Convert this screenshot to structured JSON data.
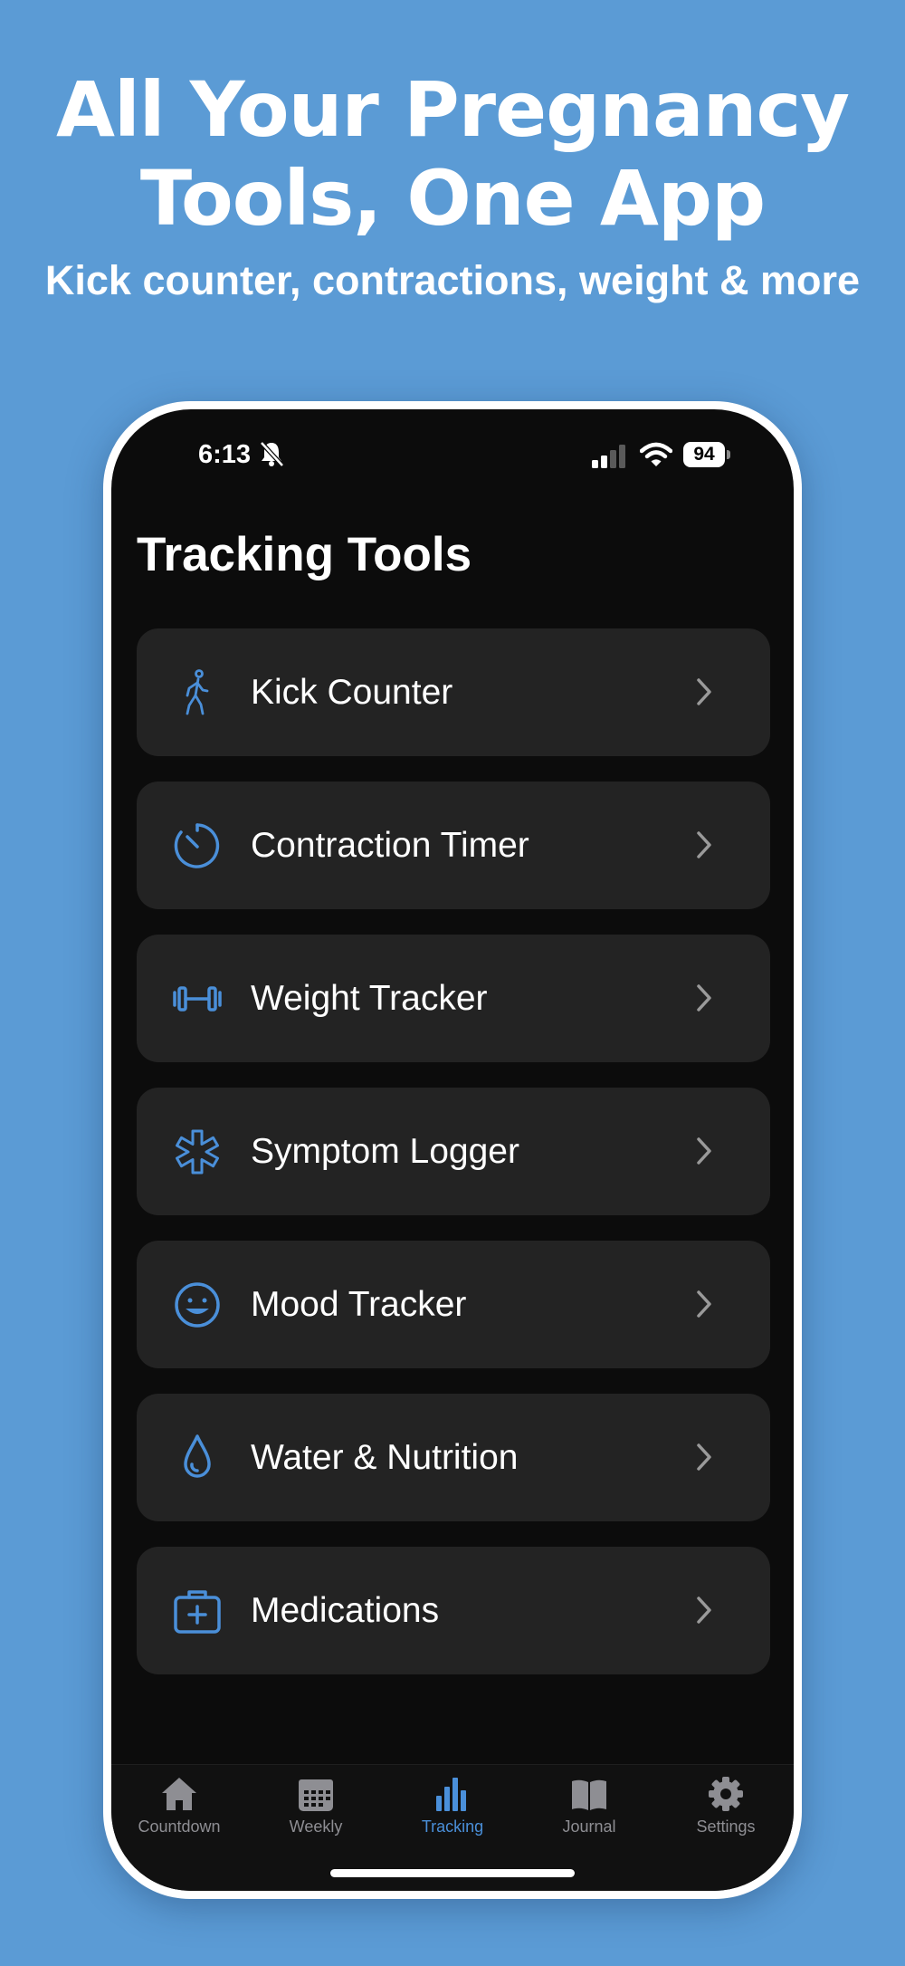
{
  "headline": {
    "line1": "All Your Pregnancy",
    "line2": "Tools, One App"
  },
  "subheadline": "Kick counter, contractions, weight & more",
  "status_bar": {
    "time": "6:13",
    "battery": "94"
  },
  "page_title": "Tracking Tools",
  "tools": [
    {
      "label": "Kick Counter",
      "icon": "walking-figure-icon"
    },
    {
      "label": "Contraction Timer",
      "icon": "timer-icon"
    },
    {
      "label": "Weight Tracker",
      "icon": "dumbbell-icon"
    },
    {
      "label": "Symptom Logger",
      "icon": "medical-star-icon"
    },
    {
      "label": "Mood Tracker",
      "icon": "smiley-icon"
    },
    {
      "label": "Water & Nutrition",
      "icon": "water-drop-icon"
    },
    {
      "label": "Medications",
      "icon": "medical-kit-icon"
    }
  ],
  "tab_bar": {
    "tabs": [
      {
        "label": "Countdown",
        "icon": "house-icon"
      },
      {
        "label": "Weekly",
        "icon": "calendar-icon"
      },
      {
        "label": "Tracking",
        "icon": "bar-chart-icon"
      },
      {
        "label": "Journal",
        "icon": "book-icon"
      },
      {
        "label": "Settings",
        "icon": "gear-icon"
      }
    ],
    "active": "Tracking"
  },
  "colors": {
    "background": "#5b9bd5",
    "accent": "#4a8fd9",
    "screen": "#0c0c0c",
    "row": "#232323"
  }
}
